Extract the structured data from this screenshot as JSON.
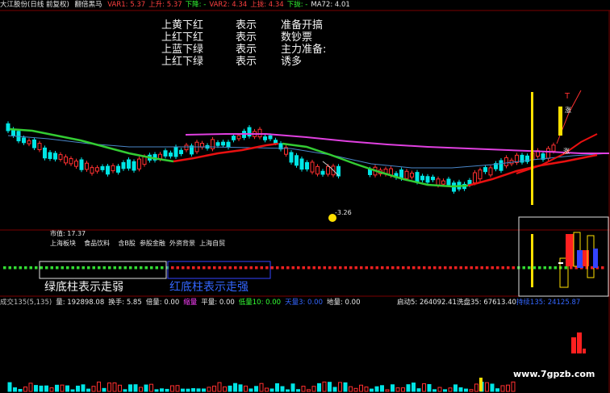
{
  "header": {
    "title": "大江股份(日线 前复权)",
    "indicator": "翻倍黑马",
    "items": [
      {
        "text": "VAR1: 5.37",
        "color": "#ff4040"
      },
      {
        "text": "上升: 5.37",
        "color": "#ff4040"
      },
      {
        "text": "下降: -",
        "color": "#33ff33"
      },
      {
        "text": "VAR2: 4.34",
        "color": "#ff4040"
      },
      {
        "text": "上拢: 4.34",
        "color": "#ff4040"
      },
      {
        "text": "下拢: -",
        "color": "#33ff33"
      },
      {
        "text": "MA72: 4.01",
        "color": "#e8e8e8"
      }
    ]
  },
  "legend": [
    {
      "signal": "上黄下红",
      "verb": "表示",
      "meaning": "准备开搞"
    },
    {
      "signal": "上红下红",
      "verb": "表示",
      "meaning": "数钞票"
    },
    {
      "signal": "上蓝下绿",
      "verb": "表示",
      "meaning": "主力准备:"
    },
    {
      "signal": "上红下绿",
      "verb": "表示",
      "meaning": "诱多"
    }
  ],
  "price_label": "-3.26",
  "candle_tag_1": "T",
  "candle_tag_2": "涨",
  "candle_tag_3": "涨",
  "info": {
    "market_value": "市值: 17.37",
    "sectors": [
      "上海板块",
      "食品饮料",
      "含B股",
      "参股金融",
      "外资背景",
      "上海自贸"
    ]
  },
  "annotations": {
    "green_base": "绿底柱表示走弱",
    "red_base": "红底柱表示走强"
  },
  "volume_bar": {
    "items": [
      {
        "text": "成交135(5,135)",
        "color": "#bdbdbd"
      },
      {
        "text": "量: 192898.08",
        "color": "#e8e8e8"
      },
      {
        "text": "换手: 5.85",
        "color": "#e8e8e8"
      },
      {
        "text": "倍量: 0.00",
        "color": "#e8e8e8"
      },
      {
        "text": "缩量",
        "color": "#ff40ff"
      },
      {
        "text": "平量: 0.00",
        "color": "#e8e8e8"
      },
      {
        "text": "低量10: 0.00",
        "color": "#33ff33"
      },
      {
        "text": "天量3: 0.00",
        "color": "#3366ff"
      },
      {
        "text": "地量: 0.00",
        "color": "#e8e8e8"
      }
    ],
    "right_items": [
      {
        "text": "启动5: 264092.41",
        "color": "#e8e8e8"
      },
      {
        "text": "洗盘35: 67613.40",
        "color": "#e8e8e8"
      },
      {
        "text": "持续135: 24125.87",
        "color": "#3366ff"
      }
    ]
  },
  "watermark": "www.7gpzb.com",
  "colors": {
    "up": "#ff3030",
    "down": "#00e5e5",
    "ma_green": "#33cc33",
    "ma_red": "#e81010",
    "ma_magenta": "#e040e0",
    "ma_blue": "#4a86c8",
    "highlight": "#ffe000"
  }
}
